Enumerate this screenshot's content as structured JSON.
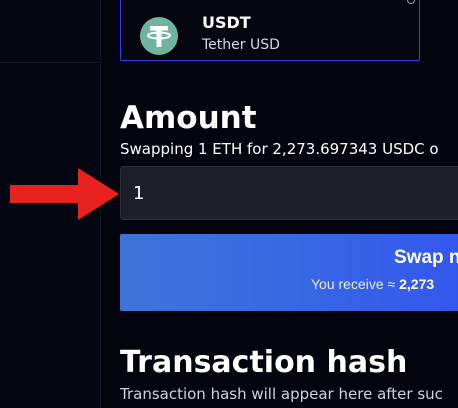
{
  "token": {
    "symbol": "USDT",
    "name": "Tether USD",
    "icon": "tether-icon",
    "icon_color": "#6fb59e"
  },
  "amount": {
    "title": "Amount",
    "description": "Swapping 1 ETH for 2,273.697343 USDC o",
    "input_value": "1"
  },
  "swap_button": {
    "label": "Swap n",
    "receive_prefix": "You receive ≈",
    "receive_amount": "2,273"
  },
  "transaction": {
    "title": "Transaction hash",
    "description": "Transaction hash will appear here after suc"
  },
  "colors": {
    "background": "#03040d",
    "card_border": "#3b3ef0",
    "button_gradient_start": "#3f73d8",
    "button_gradient_end": "#3456ec",
    "input_background": "#1d1f2a",
    "arrow": "#e8231f"
  }
}
